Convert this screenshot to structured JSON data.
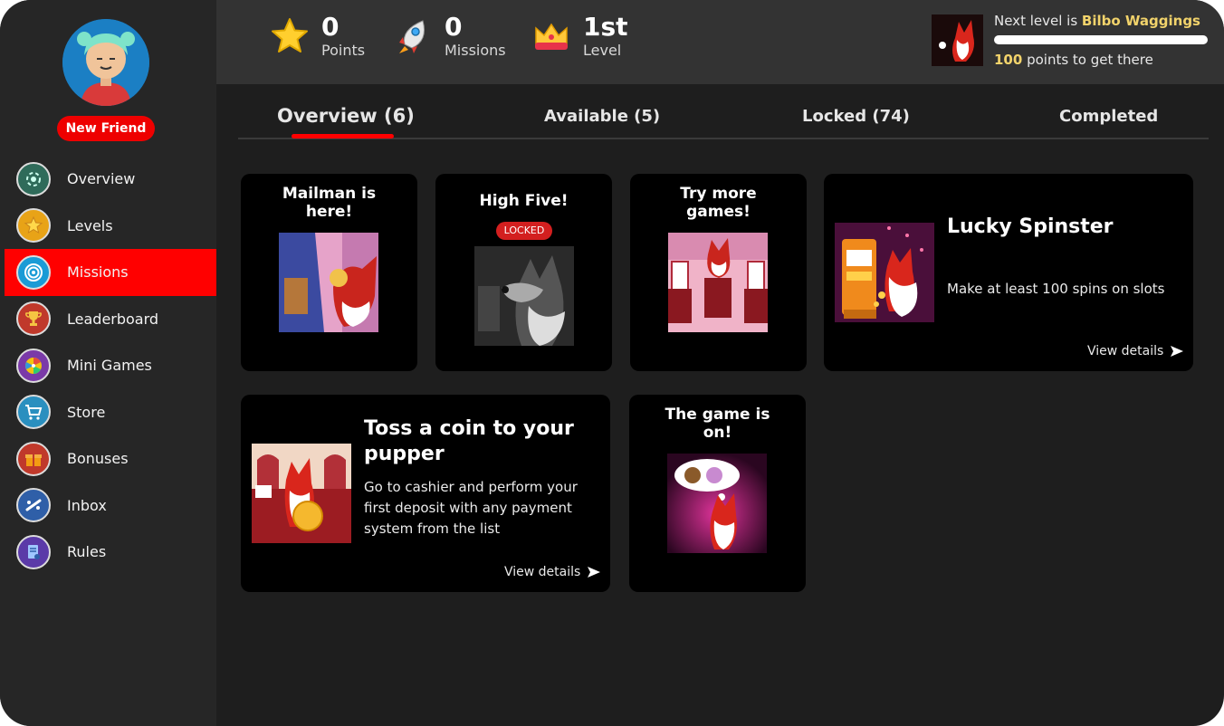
{
  "sidebar": {
    "user_badge": "New Friend",
    "items": [
      {
        "label": "Overview",
        "icon": "overview-icon"
      },
      {
        "label": "Levels",
        "icon": "star-icon"
      },
      {
        "label": "Missions",
        "icon": "target-icon"
      },
      {
        "label": "Leaderboard",
        "icon": "trophy-icon"
      },
      {
        "label": "Mini Games",
        "icon": "wheel-icon"
      },
      {
        "label": "Store",
        "icon": "cart-icon"
      },
      {
        "label": "Bonuses",
        "icon": "gift-icon"
      },
      {
        "label": "Inbox",
        "icon": "inbox-icon"
      },
      {
        "label": "Rules",
        "icon": "rules-icon"
      }
    ],
    "active_item": "Missions"
  },
  "header": {
    "points": {
      "value": "0",
      "label": "Points",
      "icon": "star-icon"
    },
    "missions": {
      "value": "0",
      "label": "Missions",
      "icon": "rocket-icon"
    },
    "level": {
      "value": "1st",
      "label": "Level",
      "icon": "crown-icon"
    },
    "next_level": {
      "prefix": "Next level is ",
      "name": "Bilbo Waggings",
      "points": "100",
      "suffix": " points to get there",
      "progress": 1.0
    }
  },
  "tabs": [
    {
      "label": "Overview (6)",
      "active": true
    },
    {
      "label": "Available (5)",
      "active": false
    },
    {
      "label": "Locked (74)",
      "active": false
    },
    {
      "label": "Completed",
      "active": false
    }
  ],
  "cards": {
    "mailman": {
      "title_line1": "Mailman is",
      "title_line2": "here!"
    },
    "high_five": {
      "title": "High Five!",
      "badge": "LOCKED"
    },
    "try_more": {
      "title_line1": "Try more",
      "title_line2": "games!"
    },
    "lucky_spinster": {
      "title": "Lucky Spinster",
      "desc": "Make at least 100 spins on slots",
      "link": "View details"
    },
    "toss_coin": {
      "title_line1": "Toss a coin to your",
      "title_line2": "pupper",
      "desc_line1": "Go to cashier and perform your",
      "desc_line2": "first deposit with any payment",
      "desc_line3": "system from the list",
      "link": "View details"
    },
    "game_on": {
      "title_line1": "The game is",
      "title_line2": "on!"
    }
  },
  "colors": {
    "accent": "#ff0000",
    "sidebar": "#262626",
    "topbar": "#333333",
    "gold": "#f2d36b"
  }
}
